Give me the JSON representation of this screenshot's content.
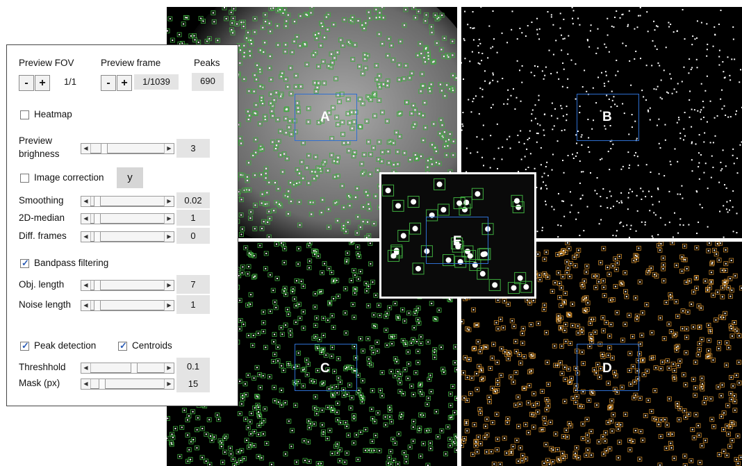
{
  "panel": {
    "preview_fov_label": "Preview FOV",
    "preview_frame_label": "Preview frame",
    "peaks_label": "Peaks",
    "minus": "-",
    "plus": "+",
    "fov_value": "1/1",
    "frame_value": "1/1039",
    "peaks_value": "690",
    "heatmap": {
      "label": "Heatmap",
      "checked": false
    },
    "brightness": {
      "label_line1": "Preview",
      "label_line2": "brighness",
      "value": "3",
      "position": 0.15
    },
    "image_correction": {
      "label": "Image correction",
      "checked": false,
      "mode": "y"
    },
    "smoothing": {
      "label": "Smoothing",
      "value": "0.02",
      "position": 0.05
    },
    "median2d": {
      "label": "2D-median",
      "value": "1",
      "position": 0.05
    },
    "diff_frames": {
      "label": "Diff. frames",
      "value": "0",
      "position": 0.05
    },
    "bandpass": {
      "label": "Bandpass filtering",
      "checked": true
    },
    "obj_length": {
      "label": "Obj. length",
      "value": "7",
      "position": 0.05
    },
    "noise_length": {
      "label": "Noise length",
      "value": "1",
      "position": 0.05
    },
    "peak_detection": {
      "label": "Peak detection",
      "checked": true
    },
    "centroids": {
      "label": "Centroids",
      "checked": true
    },
    "threshold": {
      "label": "Threshhold",
      "value": "0.1",
      "position": 0.6
    },
    "mask": {
      "label": "Mask (px)",
      "value": "15",
      "position": 0.12
    },
    "check_mark": "✓"
  },
  "quadrants": [
    {
      "label": "A"
    },
    {
      "label": "B"
    },
    {
      "label": "C"
    },
    {
      "label": "D"
    }
  ],
  "inset_label": "E",
  "colors": {
    "roi": "#2e6fd1",
    "green_box": "#3fae3f",
    "orange_box": "#c8872a",
    "spot": "#ffffff"
  }
}
